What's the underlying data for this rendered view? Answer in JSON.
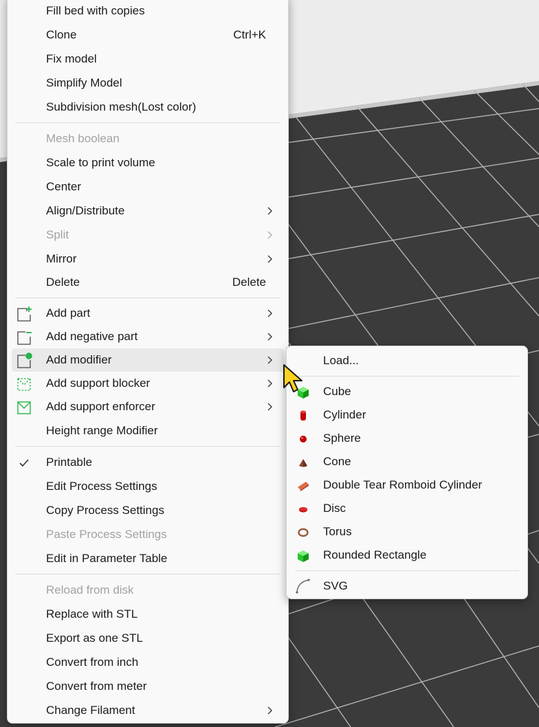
{
  "colors": {
    "menu_background": "#f9f9f9",
    "separator": "#dcdcdc",
    "disabled_text": "#a2a2a2",
    "viewport_plate": "#3b3b3b",
    "viewport_grid": "#b4b4b4",
    "viewport_backdrop": "#ececec",
    "icon_green": "#27b34a",
    "cursor_yellow": "#ffd21f"
  },
  "context_menu": {
    "items": [
      {
        "label": "Fill bed with copies"
      },
      {
        "label": "Clone",
        "shortcut": "Ctrl+K"
      },
      {
        "label": "Fix model"
      },
      {
        "label": "Simplify Model"
      },
      {
        "label": "Subdivision mesh(Lost color)"
      },
      {
        "label": "Mesh boolean",
        "disabled": true
      },
      {
        "label": "Scale to print volume"
      },
      {
        "label": "Center"
      },
      {
        "label": "Align/Distribute",
        "submenu": true
      },
      {
        "label": "Split",
        "submenu": true,
        "disabled": true
      },
      {
        "label": "Mirror",
        "submenu": true
      },
      {
        "label": "Delete",
        "shortcut": "Delete"
      },
      {
        "label": "Add part",
        "submenu": true,
        "icon": "add-part-icon"
      },
      {
        "label": "Add negative part",
        "submenu": true,
        "icon": "add-negative-part-icon"
      },
      {
        "label": "Add modifier",
        "submenu": true,
        "icon": "add-modifier-icon",
        "highlighted": true
      },
      {
        "label": "Add support blocker",
        "submenu": true,
        "icon": "support-blocker-icon"
      },
      {
        "label": "Add support enforcer",
        "submenu": true,
        "icon": "support-enforcer-icon"
      },
      {
        "label": "Height range Modifier"
      },
      {
        "label": "Printable",
        "checked": true
      },
      {
        "label": "Edit Process Settings"
      },
      {
        "label": "Copy Process Settings"
      },
      {
        "label": "Paste Process Settings",
        "disabled": true
      },
      {
        "label": "Edit in Parameter Table"
      },
      {
        "label": "Reload from disk",
        "disabled": true
      },
      {
        "label": "Replace with STL"
      },
      {
        "label": "Export as one STL"
      },
      {
        "label": "Convert from inch"
      },
      {
        "label": "Convert from meter"
      },
      {
        "label": "Change Filament",
        "submenu": true
      }
    ]
  },
  "modifier_submenu": {
    "items": [
      {
        "label": "Load...",
        "icon": "none"
      },
      {
        "label": "Cube",
        "icon": "cube-icon"
      },
      {
        "label": "Cylinder",
        "icon": "cylinder-icon"
      },
      {
        "label": "Sphere",
        "icon": "sphere-icon"
      },
      {
        "label": "Cone",
        "icon": "cone-icon"
      },
      {
        "label": "Double Tear Romboid Cylinder",
        "icon": "romboid-cylinder-icon"
      },
      {
        "label": "Disc",
        "icon": "disc-icon"
      },
      {
        "label": "Torus",
        "icon": "torus-icon"
      },
      {
        "label": "Rounded Rectangle",
        "icon": "rounded-rectangle-icon"
      },
      {
        "label": "SVG",
        "icon": "svg-curve-icon"
      }
    ]
  }
}
